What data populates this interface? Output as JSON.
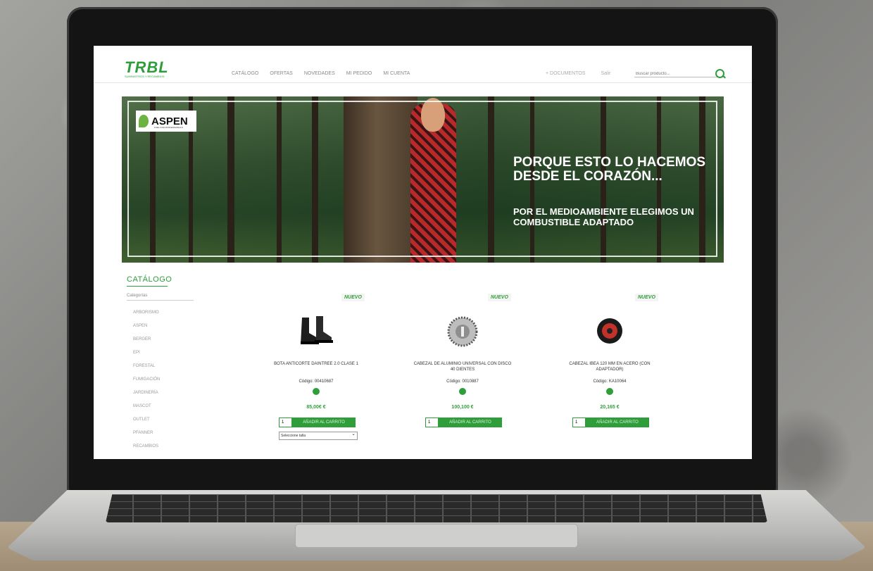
{
  "header": {
    "logo": "TRBL",
    "logo_sub": "SUMINISTROS Y RECAMBIOS",
    "nav": [
      "CATÁLOGO",
      "OFERTAS",
      "NOVEDADES",
      "MI PEDIDO",
      "MI CUENTA"
    ],
    "nav_right": [
      "+ DOCUMENTOS",
      "Salir"
    ],
    "search_placeholder": "Buscar producto...",
    "icons": [
      "search-icon"
    ]
  },
  "banner": {
    "brand": "ASPEN",
    "brand_sub": "FUEL FOR PROFESSIONALS",
    "headline": "PORQUE ESTO LO HACEMOS DESDE EL CORAZÓN...",
    "subline": "POR EL MEDIOAMBIENTE ELEGIMOS UN COMBUSTIBLE ADAPTADO"
  },
  "catalog": {
    "title": "CATÁLOGO",
    "categories_label": "Categorías",
    "categories": [
      "ARBORISMO",
      "ASPEN",
      "BERGER",
      "EPI",
      "FORESTAL",
      "FUMIGACIÓN",
      "JARDINERÍA",
      "MASCOT",
      "OUTLET",
      "PFANNER",
      "RECAMBIOS"
    ]
  },
  "products": [
    {
      "badge": "NUEVO",
      "name": "BOTA ANTICORTE DAINTREE 2.0 CLASE 1",
      "code": "Código: 00410687",
      "price": "85,00€ €",
      "qty": "1",
      "button": "AÑADIR AL CARRITO",
      "select": "Seleccione talla"
    },
    {
      "badge": "NUEVO",
      "name": "CABEZAL DE ALUMINIO UNIVERSAL CON DISCO 40 DIENTES",
      "code": "Código: 0010887",
      "price": "100,100 €",
      "qty": "1",
      "button": "AÑADIR AL CARRITO"
    },
    {
      "badge": "NUEVO",
      "name": "CABEZAL IBEA 120 MM EN ACERO (CON ADAPTADOR)",
      "code": "Código: KA10064",
      "price": "20,165 €",
      "qty": "1",
      "button": "AÑADIR AL CARRITO"
    }
  ],
  "colors": {
    "brand_green": "#2f9e3a"
  }
}
